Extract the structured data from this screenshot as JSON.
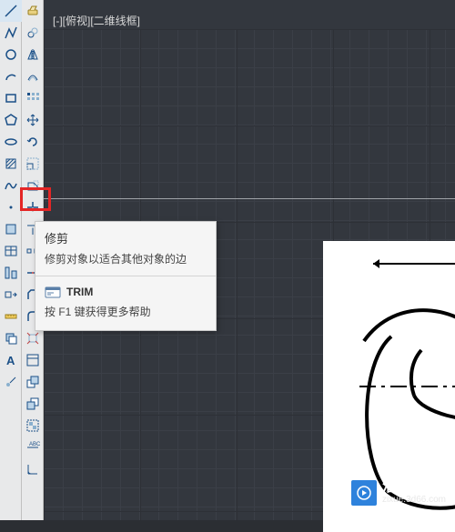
{
  "view_label": "[-][俯视][二维线框]",
  "tooltip": {
    "title": "修剪",
    "description": "修剪对象以适合其他对象的边",
    "command": "TRIM",
    "help": "按 F1 键获得更多帮助"
  },
  "watermark": {
    "title": "溜溜自学",
    "subtitle": "zixue.3d66.com"
  },
  "tools_col2": [
    "move-icon",
    "rotate-icon",
    "mirror-icon",
    "array-icon",
    "scale-icon",
    "stretch-icon",
    "offset-icon",
    "trim-icon",
    "extend-icon",
    "fillet-icon",
    "chamfer-icon",
    "break-icon",
    "join-icon",
    "explode-icon",
    "align-icon",
    "copy-icon",
    "bring-front-icon",
    "send-back-icon",
    "group-icon",
    "ungroup-icon",
    "dim-icon",
    "mtext-icon"
  ],
  "tools_col1": [
    "line-icon",
    "polyline-icon",
    "circle-icon",
    "arc-icon",
    "rectangle-icon",
    "polygon-icon",
    "ellipse-icon",
    "hatch-icon",
    "spline-icon",
    "point-icon",
    "region-icon",
    "table-icon",
    "text-icon",
    "block-icon",
    "layer-icon",
    "props-icon",
    "measure-icon",
    "draworder-icon",
    "a-text-icon",
    "leader-icon"
  ],
  "icon_semantics": {
    "trim-icon": "trim-icon"
  }
}
